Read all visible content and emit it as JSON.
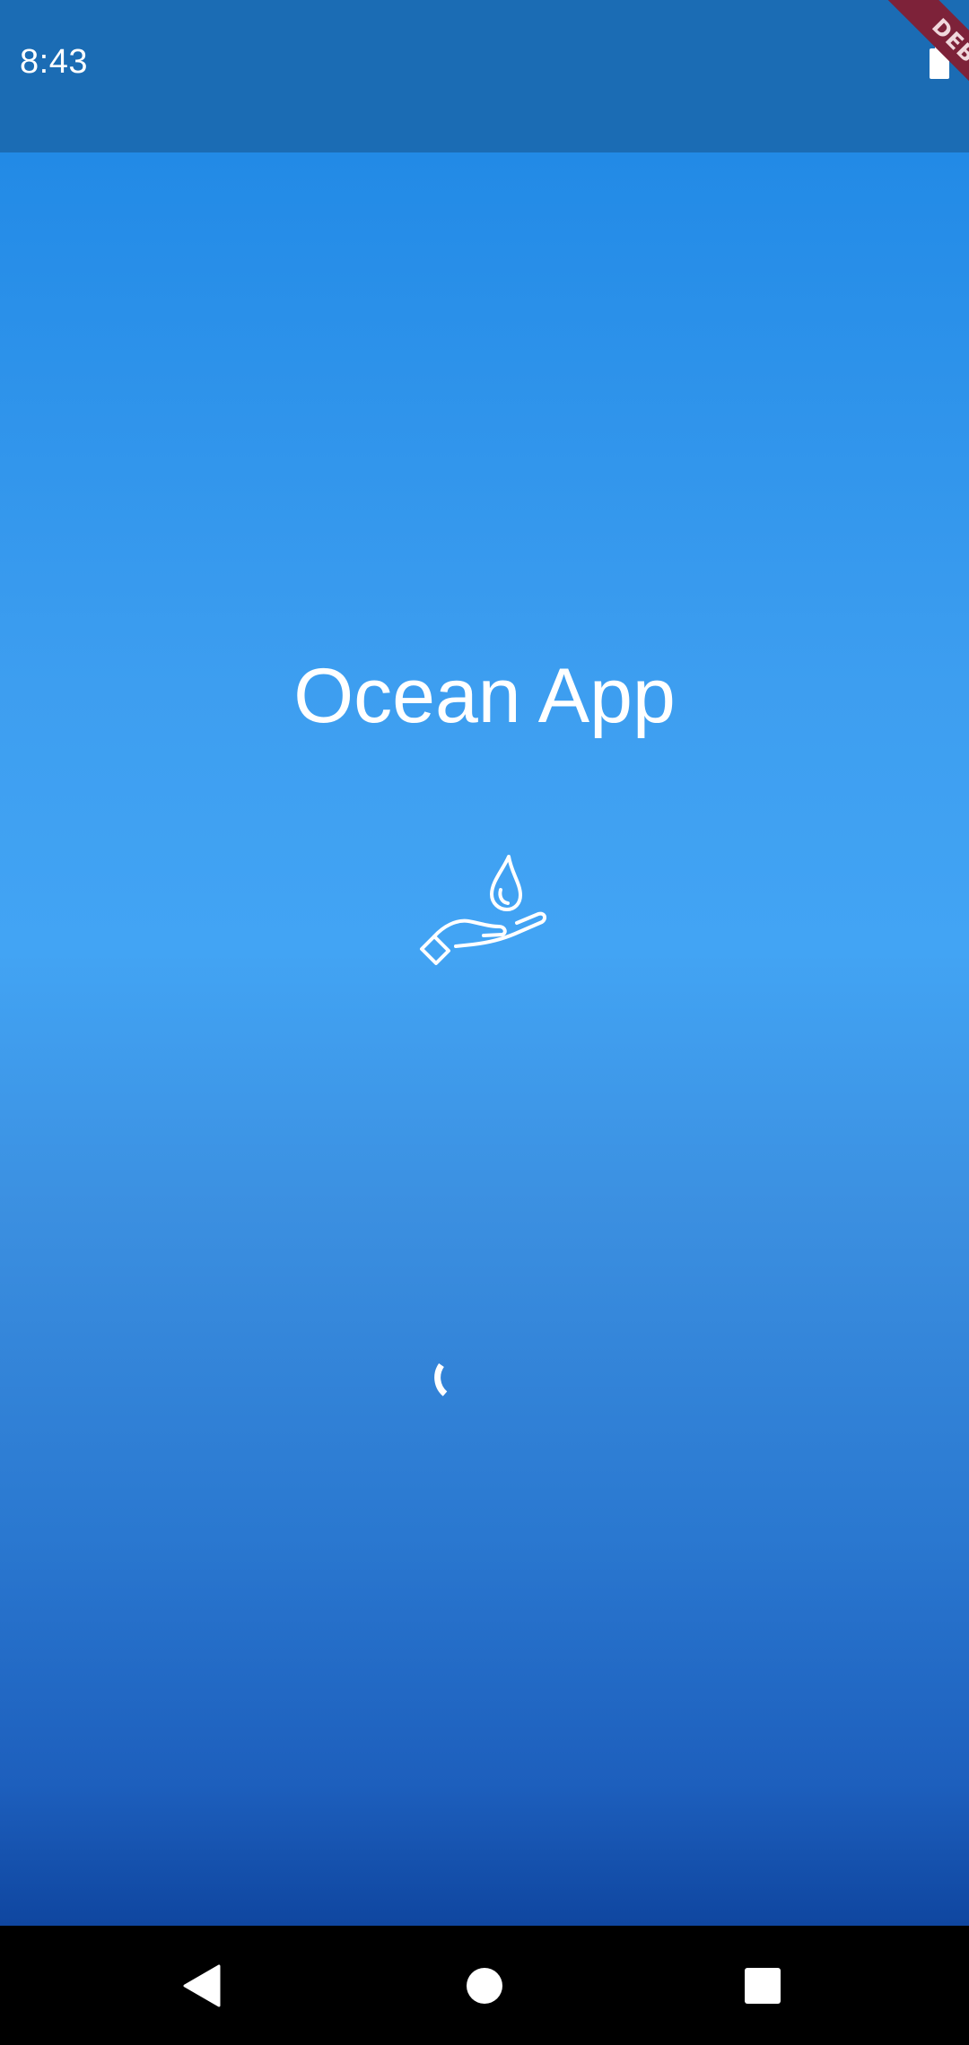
{
  "status_bar": {
    "time": "8:43",
    "background_color": "#1b6cb4",
    "battery_icon": "battery-full-icon"
  },
  "debug_banner": {
    "label": "DEBUG",
    "color": "#7d2239"
  },
  "splash": {
    "title": "Ocean App",
    "logo_icon": "hand-holding-water-drop-icon",
    "loading_indicator": "circular-progress-spinner",
    "gradient_colors": [
      "#228ae6",
      "#42a4f4",
      "#0f46a0"
    ]
  },
  "navigation_bar": {
    "back_icon": "back-triangle-icon",
    "home_icon": "home-circle-icon",
    "recents_icon": "recents-square-icon"
  }
}
